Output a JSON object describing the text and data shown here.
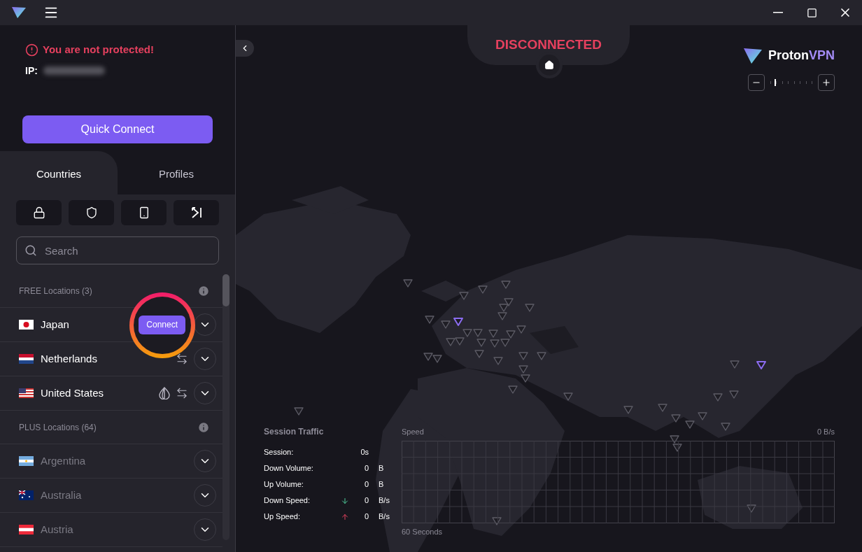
{
  "status": {
    "warning": "You are not protected!",
    "ip_label": "IP:"
  },
  "quick_connect": "Quick Connect",
  "tabs": [
    {
      "label": "Countries",
      "selected": true
    },
    {
      "label": "Profiles",
      "selected": false
    }
  ],
  "filters": [
    {
      "kind": "secure-core"
    },
    {
      "kind": "shield"
    },
    {
      "kind": "tor"
    },
    {
      "kind": "split"
    }
  ],
  "search": {
    "placeholder": "Search"
  },
  "groups": [
    {
      "title": "FREE Locations (3)",
      "countries": [
        {
          "name": "Japan",
          "kind": "jp",
          "disabled": false,
          "connect": "Connect"
        },
        {
          "name": "Netherlands",
          "kind": "nl",
          "disabled": false,
          "features": [
            {
              "kind": "p2p"
            }
          ]
        },
        {
          "name": "United States",
          "kind": "us",
          "disabled": false,
          "features": [
            {
              "kind": "tor"
            },
            {
              "kind": "p2p"
            }
          ]
        }
      ]
    },
    {
      "title": "PLUS Locations (64)",
      "countries": [
        {
          "name": "Argentina",
          "kind": "ar",
          "disabled": true
        },
        {
          "name": "Australia",
          "kind": "au",
          "disabled": true
        },
        {
          "name": "Austria",
          "kind": "at",
          "disabled": true
        }
      ]
    }
  ],
  "connection": {
    "state": "DISCONNECTED"
  },
  "brand": {
    "name": "Proton",
    "suffix": "VPN"
  },
  "zoom": {
    "level": 0.1
  },
  "pins": [
    {
      "free": false
    },
    {
      "free": false
    },
    {
      "free": false
    },
    {
      "free": false
    },
    {
      "free": false
    },
    {
      "free": false
    },
    {
      "free": false
    },
    {
      "free": false
    },
    {
      "free": false
    },
    {
      "free": false
    },
    {
      "free": true
    },
    {
      "free": false
    },
    {
      "free": false
    },
    {
      "free": false
    },
    {
      "free": false
    },
    {
      "free": false
    },
    {
      "free": false
    },
    {
      "free": false
    },
    {
      "free": false
    },
    {
      "free": false
    },
    {
      "free": false
    },
    {
      "free": false
    },
    {
      "free": false
    },
    {
      "free": false
    },
    {
      "free": false
    },
    {
      "free": false
    },
    {
      "free": false
    },
    {
      "free": false
    },
    {
      "free": false
    },
    {
      "free": false
    },
    {
      "free": false
    },
    {
      "free": false
    },
    {
      "free": true
    },
    {
      "free": false
    },
    {
      "free": false
    },
    {
      "free": false
    },
    {
      "free": false
    },
    {
      "free": false
    },
    {
      "free": false
    },
    {
      "free": false
    },
    {
      "free": false
    },
    {
      "free": false
    },
    {
      "free": false
    },
    {
      "free": false
    },
    {
      "free": false
    },
    {
      "free": false
    }
  ],
  "session_traffic": {
    "title": "Session Traffic",
    "rows": [
      {
        "label": "Session:",
        "value": "0s"
      },
      {
        "label": "Down Volume:",
        "value": "0",
        "unit": "B"
      },
      {
        "label": "Up Volume:",
        "value": "0",
        "unit": "B"
      },
      {
        "label": "Down Speed:",
        "value": "0",
        "unit": "B/s",
        "kind": "down"
      },
      {
        "label": "Up Speed:",
        "value": "0",
        "unit": "B/s",
        "kind": "up"
      }
    ]
  },
  "speed_graph": {
    "title": "Speed",
    "max": "0 B/s",
    "span": "60 Seconds"
  }
}
